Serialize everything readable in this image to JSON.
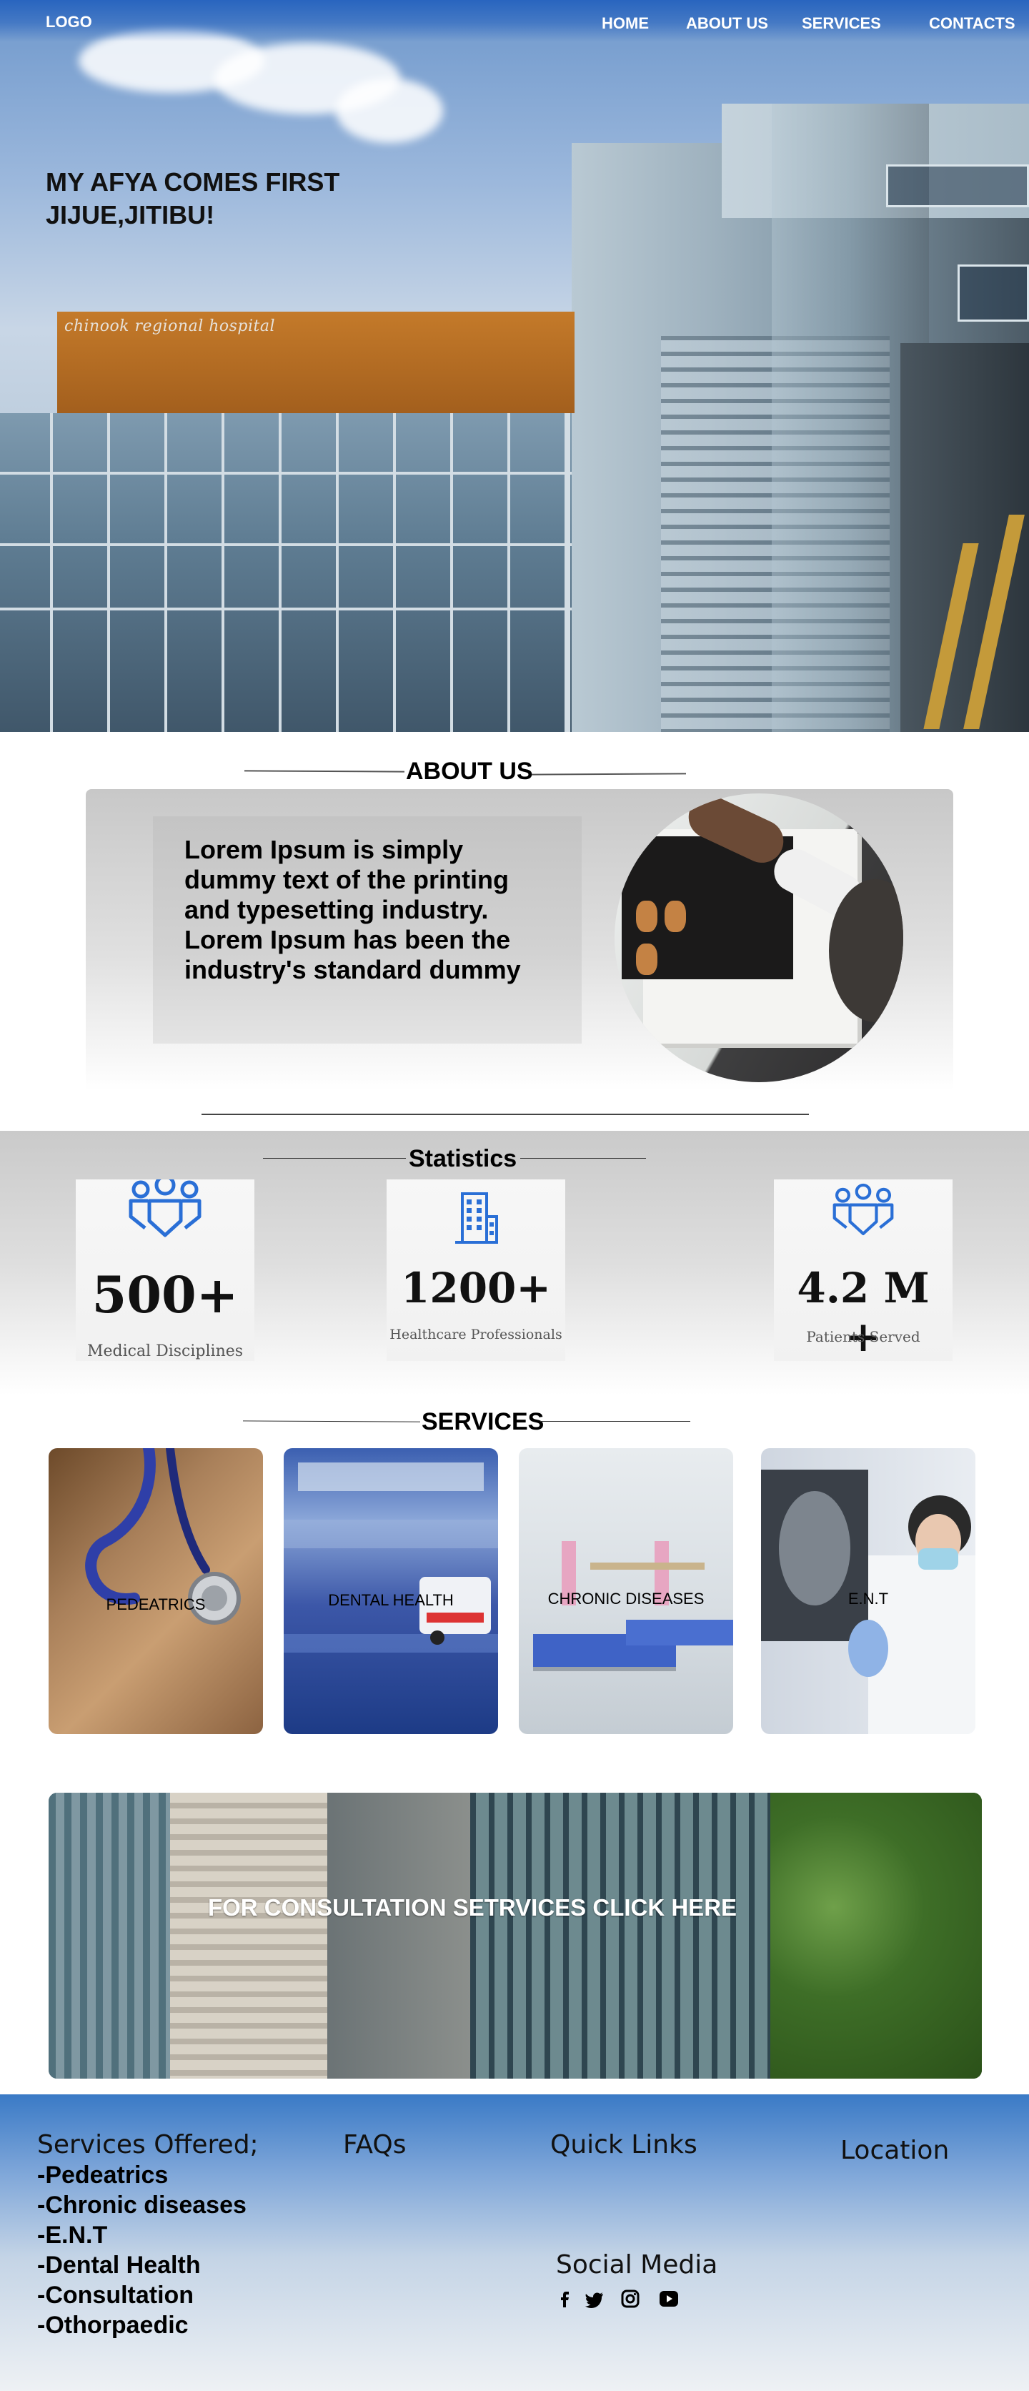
{
  "nav": {
    "logo": "LOGO",
    "links": [
      "HOME",
      "ABOUT US",
      "SERVICES",
      "CONTACTS"
    ]
  },
  "hero": {
    "title_line1": "MY AFYA COMES FIRST",
    "title_line2": "JIJUE,JITIBU!",
    "sign_text": "chinook regional hospital"
  },
  "about": {
    "heading": "ABOUT US",
    "text": "Lorem Ipsum is simply dummy text of the printing and typesetting industry. Lorem Ipsum has been the industry's standard dummy"
  },
  "stats": {
    "heading": "Statistics",
    "items": [
      {
        "value": "500+",
        "label": "Medical Disciplines",
        "icon": "people-group-icon"
      },
      {
        "value": "1200+",
        "label": "Healthcare Professionals",
        "icon": "building-icon"
      },
      {
        "value": "4.2 M +",
        "label": "Patients Served",
        "icon": "people-group-icon"
      }
    ]
  },
  "services": {
    "heading": "SERVICES",
    "items": [
      {
        "label": "PEDEATRICS"
      },
      {
        "label": "DENTAL HEALTH"
      },
      {
        "label": "CHRONIC DISEASES"
      },
      {
        "label": "E.N.T"
      }
    ]
  },
  "consultation": {
    "text": "FOR CONSULTATION SETRVICES CLICK HERE"
  },
  "footer": {
    "services_heading": "Services Offered;",
    "services_list": [
      "-Pedeatrics",
      "-Chronic diseases",
      "-E.N.T",
      "-Dental Health",
      "-Consultation",
      "-Othorpaedic"
    ],
    "faqs": "FAQs",
    "quick_links": "Quick Links",
    "location": "Location",
    "social_heading": "Social Media",
    "social_icons": [
      "facebook-icon",
      "twitter-icon",
      "instagram-icon",
      "youtube-icon"
    ]
  },
  "colors": {
    "brand_blue": "#2f6fc4",
    "icon_blue": "#2a6fd6"
  }
}
